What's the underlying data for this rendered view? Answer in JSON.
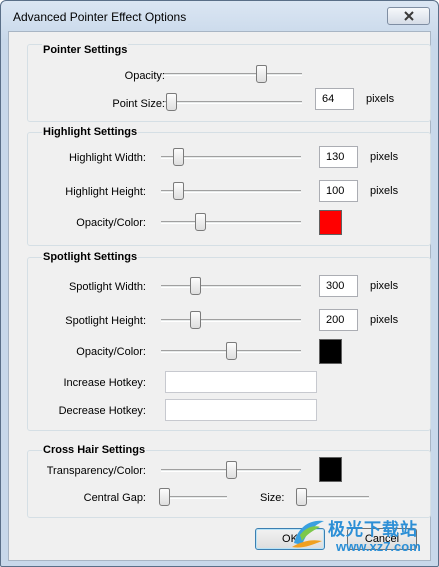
{
  "window": {
    "title": "Advanced Pointer Effect Options"
  },
  "pointer": {
    "title": "Pointer Settings",
    "opacity_label": "Opacity:",
    "opacity_value": 0.7,
    "point_size_label": "Point Size:",
    "point_size_slider": 0.05,
    "point_size_value": "64",
    "point_size_unit": "pixels"
  },
  "highlight": {
    "title": "Highlight Settings",
    "width_label": "Highlight Width:",
    "width_slider": 0.12,
    "width_value": "130",
    "width_unit": "pixels",
    "height_label": "Highlight Height:",
    "height_slider": 0.12,
    "height_value": "100",
    "height_unit": "pixels",
    "color_label": "Opacity/Color:",
    "color_slider": 0.28,
    "color": "#ff0000"
  },
  "spotlight": {
    "title": "Spotlight Settings",
    "width_label": "Spotlight Width:",
    "width_slider": 0.24,
    "width_value": "300",
    "width_unit": "pixels",
    "height_label": "Spotlight Height:",
    "height_slider": 0.24,
    "height_value": "200",
    "height_unit": "pixels",
    "color_label": "Opacity/Color:",
    "color_slider": 0.5,
    "color": "#000000",
    "increase_label": "Increase Hotkey:",
    "increase_value": "",
    "decrease_label": "Decrease Hotkey:",
    "decrease_value": ""
  },
  "crosshair": {
    "title": "Cross Hair Settings",
    "transparency_label": "Transparency/Color:",
    "transparency_slider": 0.5,
    "color": "#000000",
    "gap_label": "Central Gap:",
    "gap_slider": 0.05,
    "size_label": "Size:",
    "size_slider": 0.02
  },
  "buttons": {
    "ok": "OK",
    "cancel": "Cancel"
  },
  "watermark": {
    "text": "极光下载站",
    "url": "www.xz7.com"
  },
  "icons": {
    "close": "close-icon",
    "watermark_logo": "aurora-logo-icon"
  }
}
